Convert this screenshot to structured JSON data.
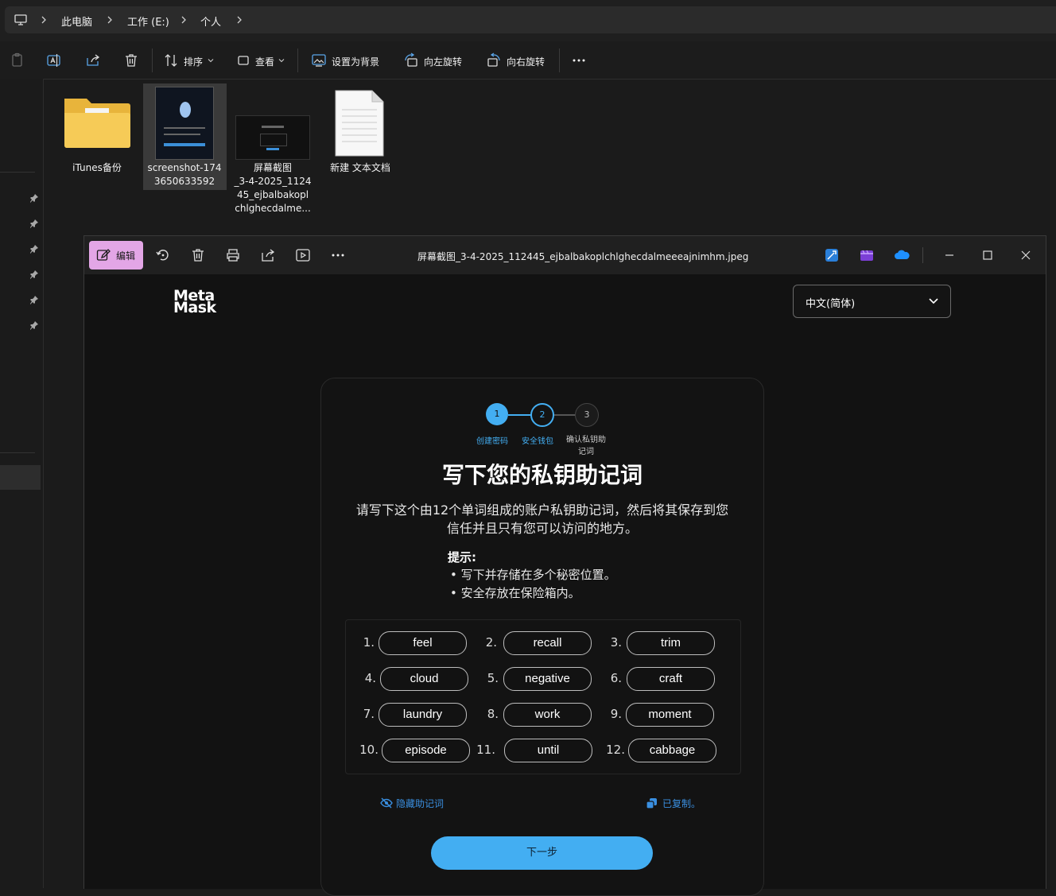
{
  "address_bar": {
    "crumbs": [
      "此电脑",
      "工作 (E:)",
      "个人"
    ]
  },
  "toolbar": {
    "sort_label": "排序",
    "view_label": "查看",
    "set_background_label": "设置为背景",
    "rotate_left_label": "向左旋转",
    "rotate_right_label": "向右旋转"
  },
  "files": [
    {
      "name": "iTunes备份",
      "type": "folder"
    },
    {
      "name_line1": "screenshot-174",
      "name_line2": "3650633592",
      "type": "image",
      "selected": true
    },
    {
      "name_line1": "屏幕截图",
      "name_line2": "_3-4-2025_1124",
      "name_line3": "45_ejbalbakopl",
      "name_line4": "chlghecdalme...",
      "type": "image"
    },
    {
      "name": "新建 文本文档",
      "type": "text"
    }
  ],
  "viewer": {
    "edit_label": "编辑",
    "filename": "屏幕截图_3-4-2025_112445_ejbalbakoplchlghecdalmeeeajnimhm.jpeg"
  },
  "metamask": {
    "logo_line1": "Meta",
    "logo_line2": "Mask",
    "language": "中文(简体)",
    "steps": [
      {
        "number": "1",
        "label": "创建密码"
      },
      {
        "number": "2",
        "label": "安全钱包"
      },
      {
        "number": "3",
        "label_line1": "确认私钥助",
        "label_line2": "记词"
      }
    ],
    "title": "写下您的私钥助记词",
    "description_line1": "请写下这个由12个单词组成的账户私钥助记词，然后将其保存到您",
    "description_line2": "信任并且只有您可以访问的地方。",
    "tips_title": "提示:",
    "tips": [
      "写下并存储在多个秘密位置。",
      "安全存放在保险箱内。"
    ],
    "words": [
      {
        "num": "1.",
        "word": "feel"
      },
      {
        "num": "2.",
        "word": "recall"
      },
      {
        "num": "3.",
        "word": "trim"
      },
      {
        "num": "4.",
        "word": "cloud"
      },
      {
        "num": "5.",
        "word": "negative"
      },
      {
        "num": "6.",
        "word": "craft"
      },
      {
        "num": "7.",
        "word": "laundry"
      },
      {
        "num": "8.",
        "word": "work"
      },
      {
        "num": "9.",
        "word": "moment"
      },
      {
        "num": "10.",
        "word": "episode"
      },
      {
        "num": "11.",
        "word": "until"
      },
      {
        "num": "12.",
        "word": "cabbage"
      }
    ],
    "hide_label": "隐藏助记词",
    "copied_label": "已复制。",
    "next_label": "下一步"
  },
  "colors": {
    "accent_blue": "#43aef2",
    "edit_pink": "#e3a6e6"
  }
}
